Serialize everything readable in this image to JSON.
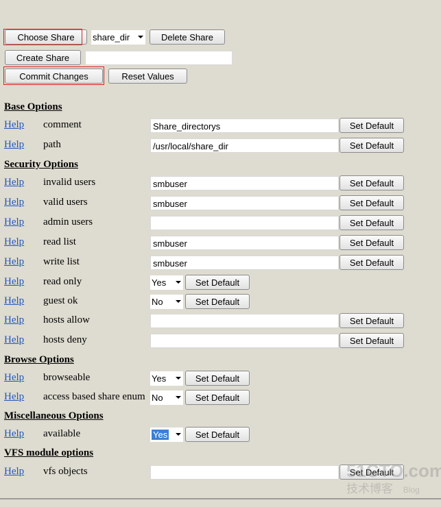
{
  "top": {
    "choose_share": "Choose Share",
    "share_select": "share_dir",
    "delete_share": "Delete Share",
    "create_share": "Create Share",
    "create_share_value": "",
    "commit": "Commit Changes",
    "reset": "Reset Values"
  },
  "help_label": "Help",
  "set_default": "Set Default",
  "sections": {
    "base": {
      "title": "Base Options",
      "rows": [
        {
          "label": "comment",
          "value": "Share_directorys"
        },
        {
          "label": "path",
          "value": "/usr/local/share_dir"
        }
      ]
    },
    "security": {
      "title": "Security Options",
      "rows": [
        {
          "label": "invalid users",
          "value": "smbuser"
        },
        {
          "label": "valid users",
          "value": "smbuser"
        },
        {
          "label": "admin users",
          "value": ""
        },
        {
          "label": "read list",
          "value": "smbuser"
        },
        {
          "label": "write list",
          "value": "smbuser"
        },
        {
          "label": "read only",
          "value": "Yes"
        },
        {
          "label": "guest ok",
          "value": "No"
        },
        {
          "label": "hosts allow",
          "value": ""
        },
        {
          "label": "hosts deny",
          "value": ""
        }
      ]
    },
    "browse": {
      "title": "Browse Options",
      "rows": [
        {
          "label": "browseable",
          "value": "Yes"
        },
        {
          "label": "access based share enum",
          "value": "No"
        }
      ]
    },
    "misc": {
      "title": "Miscellaneous Options",
      "rows": [
        {
          "label": "available",
          "value": "Yes"
        }
      ]
    },
    "vfs": {
      "title": "VFS module options",
      "rows": [
        {
          "label": "vfs objects",
          "value": ""
        }
      ]
    }
  },
  "watermark": {
    "site": "51CTO.com",
    "sub": "技术博客",
    "blog": "Blog"
  }
}
